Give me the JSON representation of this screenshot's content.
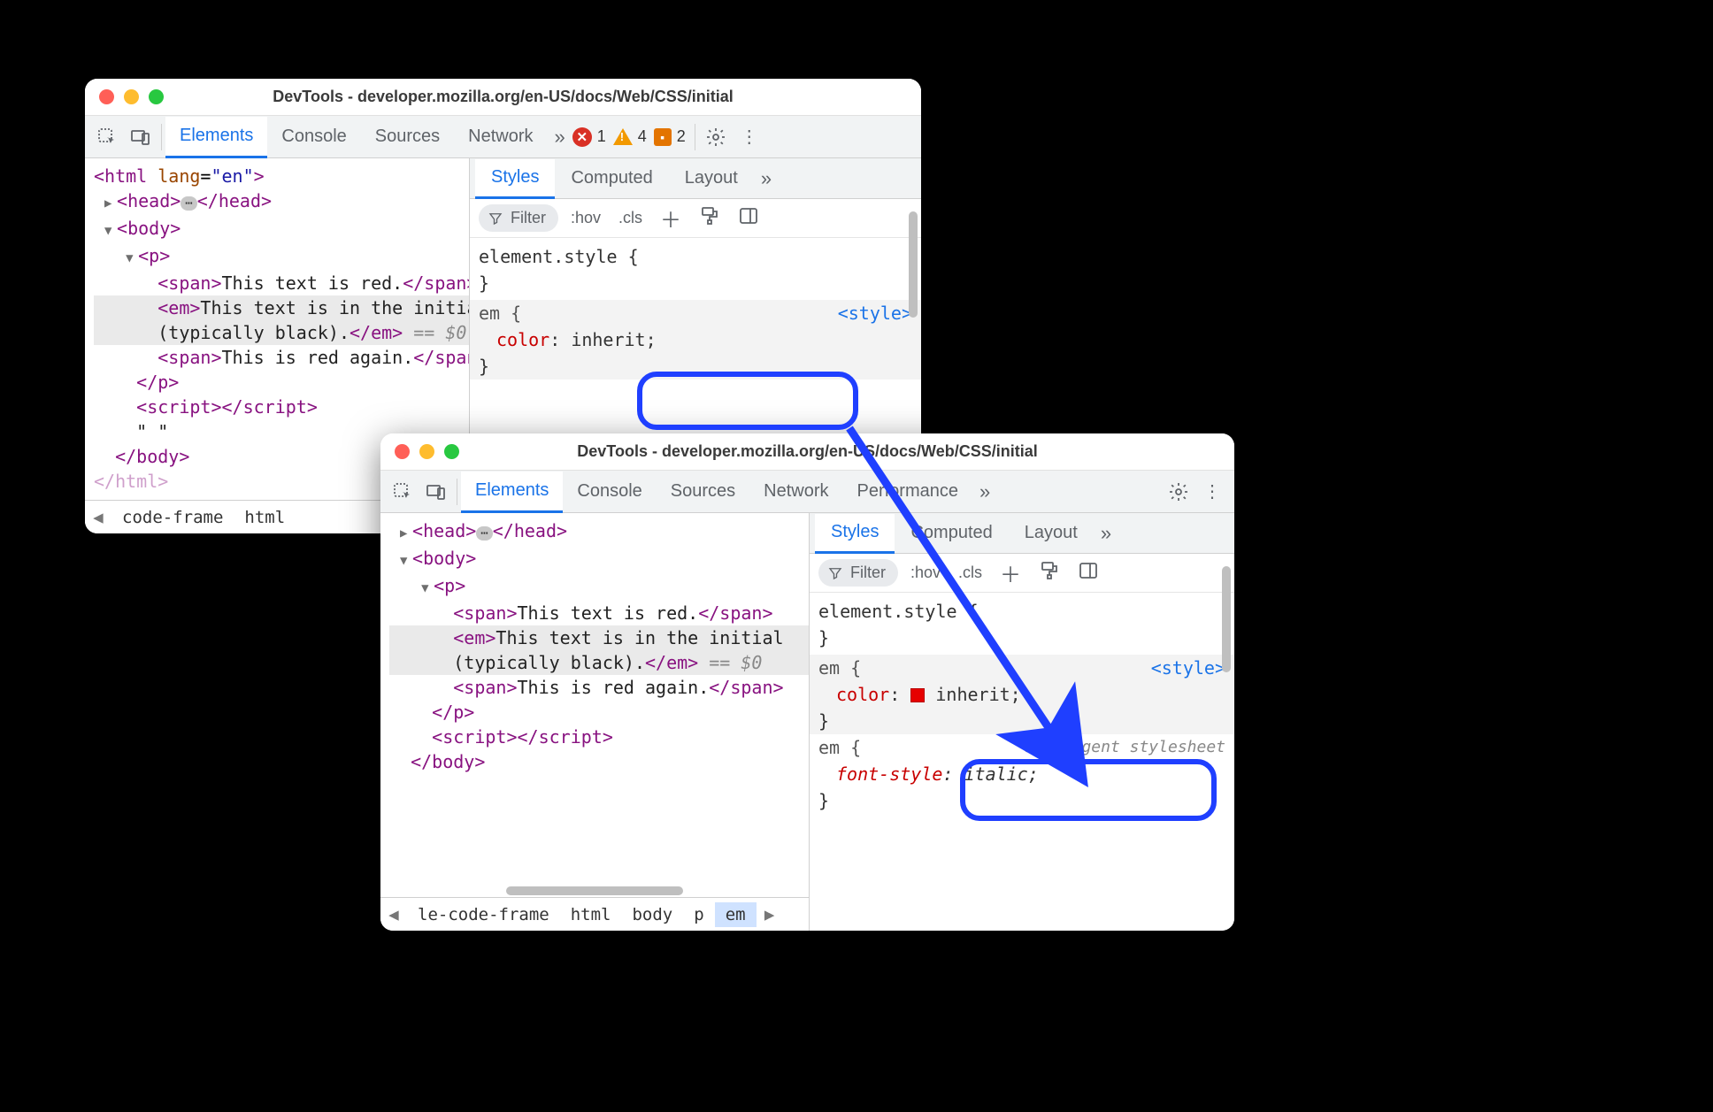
{
  "windows": [
    {
      "id": "win1",
      "title": "DevTools - developer.mozilla.org/en-US/docs/Web/CSS/initial",
      "tabs": [
        "Elements",
        "Console",
        "Sources",
        "Network"
      ],
      "active_tab": "Elements",
      "status": {
        "errors": 1,
        "warnings": 4,
        "issues": 2
      },
      "dom": {
        "html_open": "<html lang=\"en\">",
        "head": {
          "open": "<head>",
          "close": "</head>"
        },
        "body_open": "<body>",
        "p_open": "<p>",
        "span1": {
          "open": "<span>",
          "text": "This text is red.",
          "close": "</span>"
        },
        "em": {
          "open": "<em>",
          "text": "This text is in the initial (typically black).",
          "close": "</em>",
          "eq": " == $0"
        },
        "span2": {
          "open": "<span>",
          "text": "This is red again.",
          "close": "</span>"
        },
        "p_close": "</p>",
        "script": {
          "open": "<script>",
          "close": "</script>"
        },
        "textnode": "\" \"",
        "body_close": "</body>",
        "html_close": "</html>"
      },
      "breadcrumbs": [
        "code-frame",
        "html"
      ],
      "styles_tabs": [
        "Styles",
        "Computed",
        "Layout"
      ],
      "styles_active": "Styles",
      "filter_placeholder": "Filter",
      "toolbar_buttons": [
        ":hov",
        ".cls"
      ],
      "rules": {
        "element_style": "element.style {",
        "em_selector": "em {",
        "source": "<style>",
        "color_prop": "color",
        "color_value": "inherit;"
      }
    },
    {
      "id": "win2",
      "title": "DevTools - developer.mozilla.org/en-US/docs/Web/CSS/initial",
      "tabs": [
        "Elements",
        "Console",
        "Sources",
        "Network",
        "Performance"
      ],
      "active_tab": "Elements",
      "dom": {
        "head": {
          "open": "<head>",
          "close": "</head>"
        },
        "body_open": "<body>",
        "p_open": "<p>",
        "span1": {
          "open": "<span>",
          "text": "This text is red.",
          "close": "</span>"
        },
        "em": {
          "open": "<em>",
          "text": "This text is in the initial (typically black).",
          "close": "</em>",
          "eq": " == $0"
        },
        "span2": {
          "open": "<span>",
          "text": "This is red again.",
          "close": "</span>"
        },
        "p_close": "</p>",
        "script": {
          "open": "<script>",
          "close": "</script>"
        },
        "body_close": "</body>"
      },
      "breadcrumbs": [
        "le-code-frame",
        "html",
        "body",
        "p",
        "em"
      ],
      "breadcrumb_selected": "em",
      "styles_tabs": [
        "Styles",
        "Computed",
        "Layout"
      ],
      "styles_active": "Styles",
      "filter_placeholder": "Filter",
      "toolbar_buttons": [
        ":hov",
        ".cls"
      ],
      "rules": {
        "element_style": "element.style {",
        "em_selector": "em {",
        "source": "<style>",
        "color_prop": "color",
        "color_value": "inherit;",
        "ua_label": "user agent stylesheet",
        "fontstyle_prop": "font-style",
        "fontstyle_value": "italic;"
      }
    }
  ],
  "annotation": {
    "note": "Blue rounded boxes highlight 'color: inherit;' in both panels; arrow points from win1 rule to win2 rule (with color swatch).",
    "swatch_color": "#e60000"
  }
}
